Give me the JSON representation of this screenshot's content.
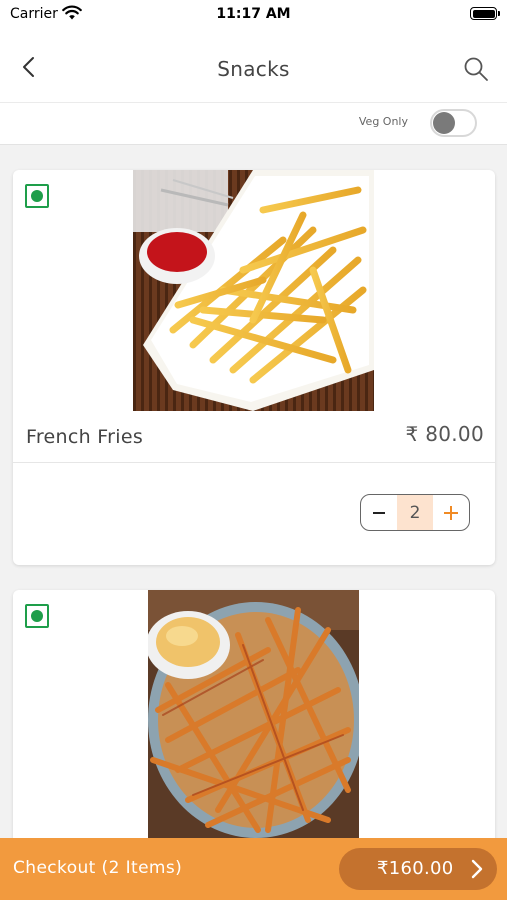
{
  "status_bar": {
    "carrier": "Carrier",
    "time": "11:17 AM"
  },
  "nav": {
    "title": "Snacks",
    "back_icon": "chevron-left-icon",
    "search_icon": "search-icon"
  },
  "filter": {
    "veg_only_label": "Veg Only",
    "veg_only_enabled": false
  },
  "items": [
    {
      "name": "French Fries",
      "price": "₹ 80.00",
      "quantity": "2",
      "veg": true
    },
    {
      "veg": true
    }
  ],
  "checkout": {
    "label": "Checkout (2 Items)",
    "total": "₹160.00"
  },
  "colors": {
    "accent": "#f29a3e",
    "accent_dark": "#c4722e",
    "veg_green": "#1e9e4a",
    "qty_bg": "#fde3cf"
  }
}
